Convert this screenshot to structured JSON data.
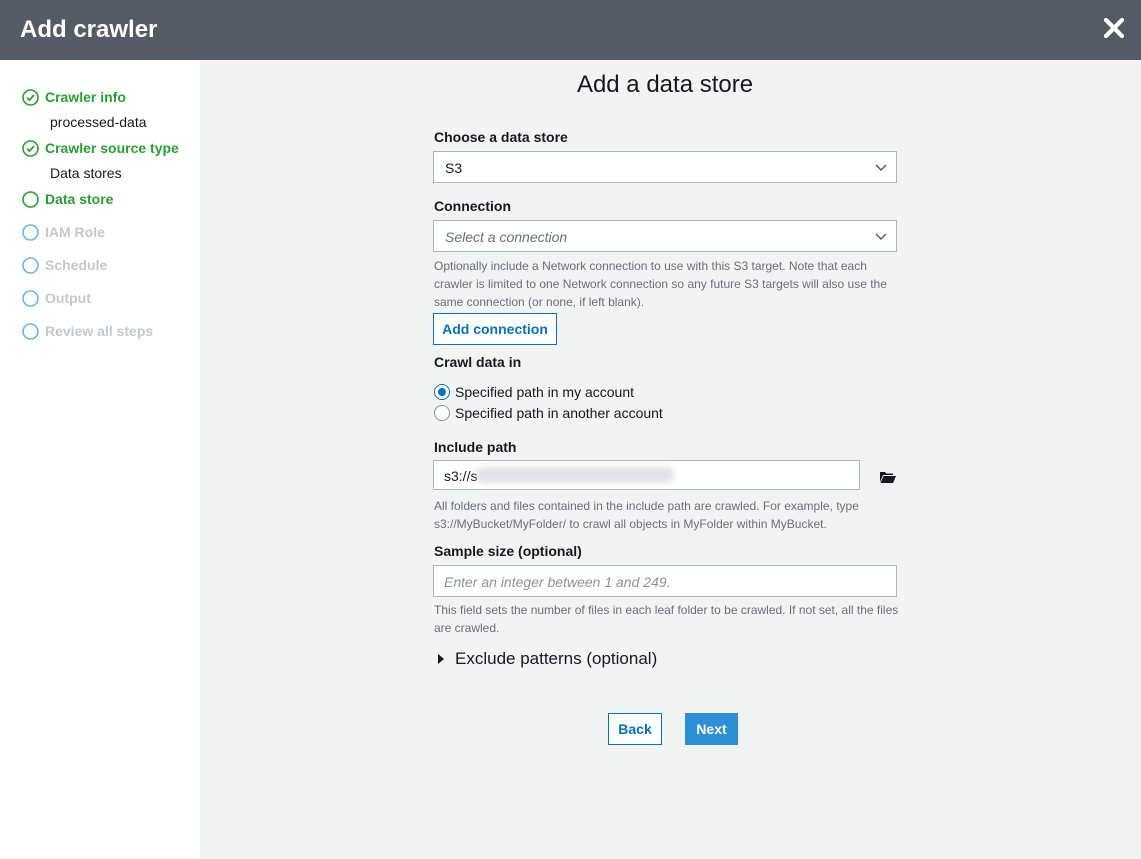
{
  "header": {
    "title": "Add crawler"
  },
  "sidebar": {
    "steps": [
      {
        "label": "Crawler info",
        "state": "done",
        "sub": "processed-data"
      },
      {
        "label": "Crawler source type",
        "state": "done",
        "sub": "Data stores"
      },
      {
        "label": "Data store",
        "state": "current"
      },
      {
        "label": "IAM Role",
        "state": "todo"
      },
      {
        "label": "Schedule",
        "state": "todo"
      },
      {
        "label": "Output",
        "state": "todo"
      },
      {
        "label": "Review all steps",
        "state": "todo"
      }
    ]
  },
  "main": {
    "title": "Add a data store",
    "data_store": {
      "label": "Choose a data store",
      "value": "S3"
    },
    "connection": {
      "label": "Connection",
      "placeholder": "Select a connection",
      "help": "Optionally include a Network connection to use with this S3 target. Note that each crawler is limited to one Network connection so any future S3 targets will also use the same connection (or none, if left blank).",
      "add_button": "Add connection"
    },
    "crawl_data_in": {
      "label": "Crawl data in",
      "options": [
        "Specified path in my account",
        "Specified path in another account"
      ],
      "selected": "Specified path in my account"
    },
    "include_path": {
      "label": "Include path",
      "value": "s3://s",
      "help": "All folders and files contained in the include path are crawled. For example, type s3://MyBucket/MyFolder/ to crawl all objects in MyFolder within MyBucket."
    },
    "sample_size": {
      "label": "Sample size (optional)",
      "placeholder": "Enter an integer between 1 and 249.",
      "help": "This field sets the number of files in each leaf folder to be crawled. If not set, all the files are crawled."
    },
    "exclude_patterns": "Exclude patterns (optional)",
    "buttons": {
      "back": "Back",
      "next": "Next"
    }
  },
  "colors": {
    "header_bg": "#545b64",
    "success_green": "#2a9d34",
    "link_blue": "#0073bb",
    "primary_button": "#2d8fd6",
    "step_todo": "#6ab5e6"
  }
}
